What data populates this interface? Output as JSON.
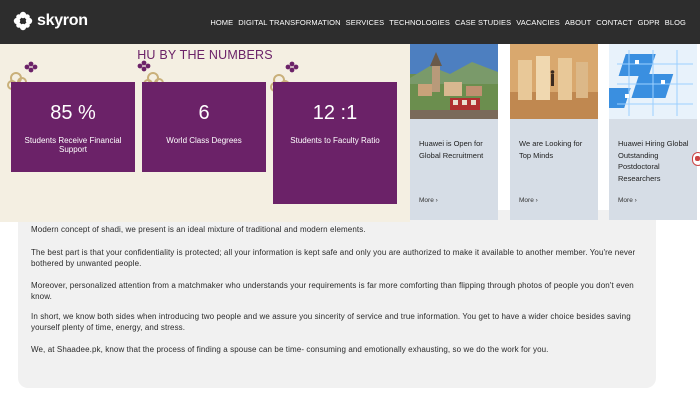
{
  "brand": {
    "name": "skyron"
  },
  "nav": {
    "items": [
      "HOME",
      "DIGITAL TRANSFORMATION",
      "SERVICES",
      "TECHNOLOGIES",
      "CASE STUDIES",
      "VACANCIES",
      "ABOUT",
      "CONTACT",
      "GDPR",
      "BLOG"
    ]
  },
  "stats": {
    "title": "HU BY THE NUMBERS",
    "cards": [
      {
        "value": "85 %",
        "label": "Students Receive Financial Support"
      },
      {
        "value": "6",
        "label": "World Class Degrees"
      },
      {
        "value": "12 :1",
        "label": "Students to Faculty Ratio"
      }
    ]
  },
  "news": [
    {
      "title": "Huawei is Open for Global Recruitment",
      "more": "More ›"
    },
    {
      "title": "We are Looking for Top Minds",
      "more": "More ›"
    },
    {
      "title": "Huawei Hiring Global Outstanding Postdoctoral Researchers",
      "more": "More ›"
    }
  ],
  "content": {
    "paragraphs": [
      "Modern concept of shadi, we present is an ideal mixture of traditional and modern elements.",
      "The best part is that your confidentiality is protected; all your information is kept safe and only you are authorized to make it available to another member. You're never bothered by unwanted people.",
      "Moreover, personalized attention from a matchmaker who understands your requirements is far more comforting than flipping through photos of people you don't even know.",
      "In short, we know both sides when introducing two people and we assure you sincerity of service and true information. You get to have a wider choice besides saving yourself plenty of time, energy, and stress.",
      "We, at Shaadee.pk, know that the process of finding a spouse can be time- consuming and emotionally exhausting, so we do the work for you."
    ]
  },
  "colors": {
    "topbar": "#2d2d2d",
    "stat_card": "#6b2268",
    "stats_bg": "#f4efe2",
    "news_bg": "#d6dde6",
    "content_bg": "#f1f1f1"
  }
}
